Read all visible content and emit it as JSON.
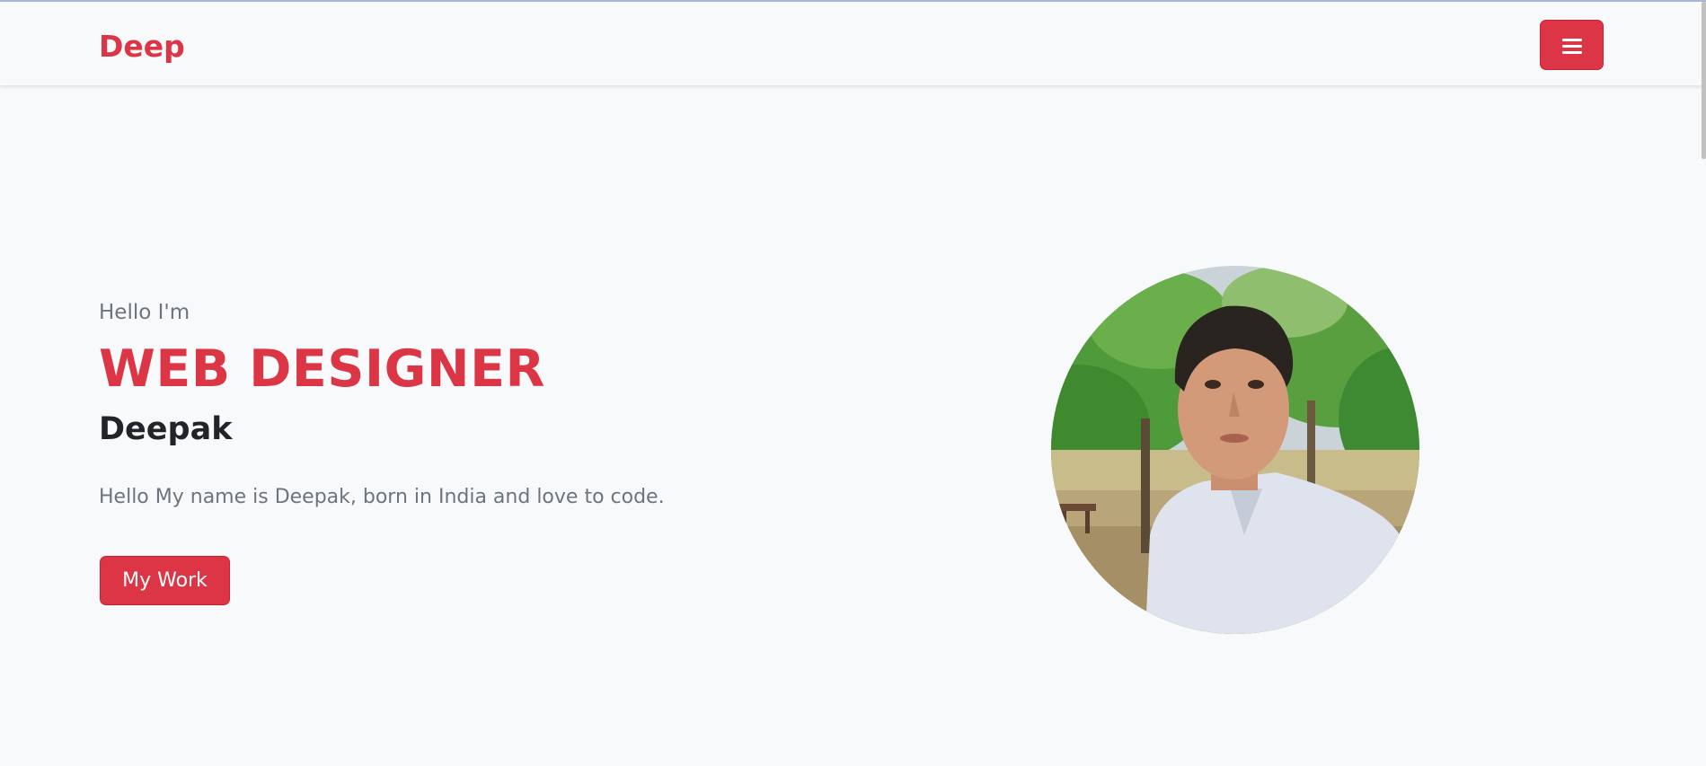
{
  "colors": {
    "accent": "#dc3545",
    "background": "#f8f9fa",
    "heading": "#212529",
    "muted": "#6c757d"
  },
  "navbar": {
    "brand": "Deep",
    "menu_icon": "hamburger-menu-icon"
  },
  "hero": {
    "greeting": "Hello I'm",
    "title": "WEB DESIGNER",
    "name": "Deepak",
    "description": "Hello My name is Deepak, born in India and love to code.",
    "button_label": "My Work"
  },
  "profile": {
    "image": "profile-photo"
  }
}
